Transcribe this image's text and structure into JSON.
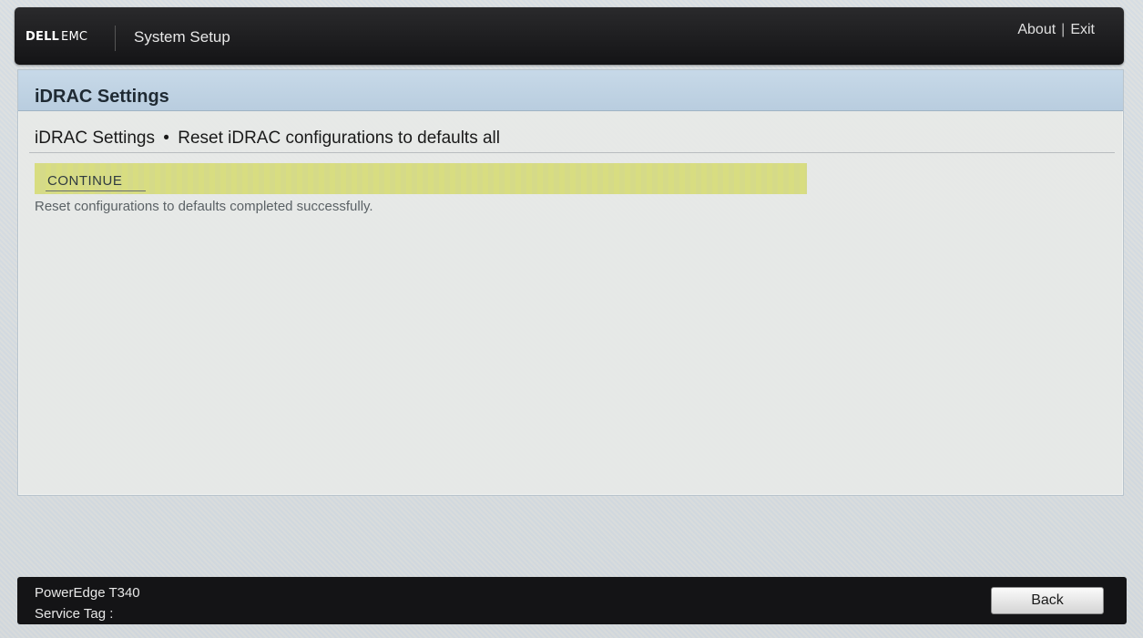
{
  "header": {
    "logo_brand": "DELL",
    "logo_suffix": "EMC",
    "app_title": "System Setup",
    "about_label": "About",
    "link_separator": "|",
    "exit_label": "Exit"
  },
  "panel": {
    "title": "iDRAC Settings",
    "breadcrumb_root": "iDRAC Settings",
    "breadcrumb_separator": "•",
    "breadcrumb_current": "Reset iDRAC configurations to defaults all",
    "continue_label": "CONTINUE",
    "status_message": "Reset configurations to defaults completed successfully."
  },
  "footer": {
    "model": "PowerEdge T340",
    "service_tag_label": "Service Tag :",
    "back_label": "Back"
  },
  "colors": {
    "header_bg": "#1c1c1e",
    "title_bar_bg": "#bfd3e4",
    "selected_row_bg": "#d7dc87",
    "footer_bg": "#141416"
  }
}
